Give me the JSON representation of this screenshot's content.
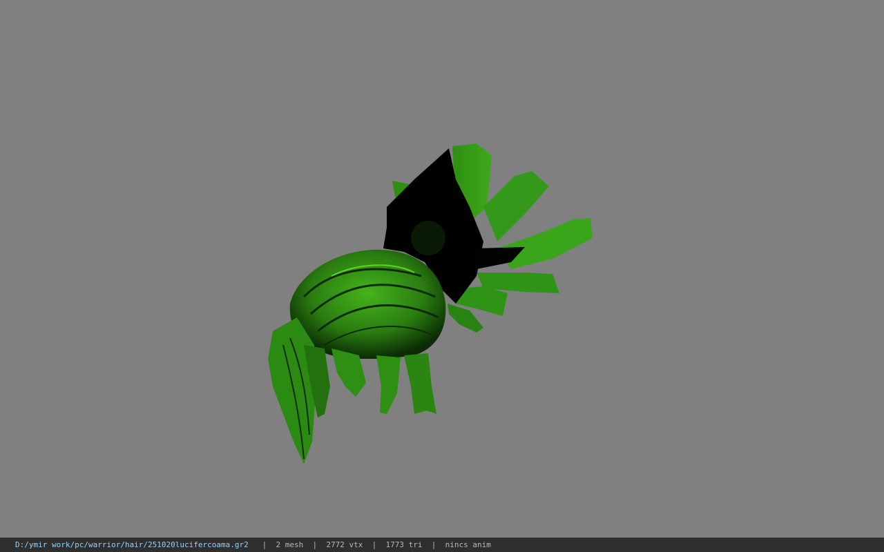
{
  "viewport": {
    "background_color": "#808080",
    "model": {
      "subject": "hair mesh",
      "colors": {
        "primary": "#2f8f12",
        "highlight": "#46b31c",
        "shadow": "#000000"
      }
    }
  },
  "statusbar": {
    "file_path": "D:/ymir work/pc/warrior/hair/251020lucifercoama.gr2",
    "separator": "|",
    "mesh_count": "2 mesh",
    "vertex_count": "2772 vtx",
    "triangle_count": "1773 tri",
    "anim_status": "nincs anim"
  }
}
